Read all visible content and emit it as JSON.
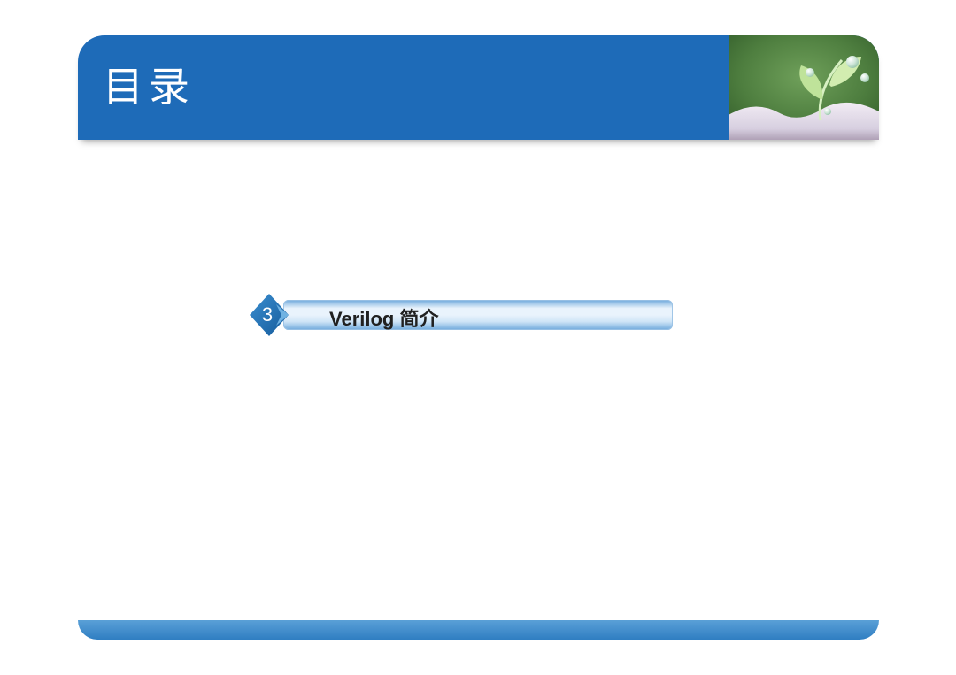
{
  "header": {
    "title": "目录"
  },
  "toc": {
    "item": {
      "number": "3",
      "label": "Verilog 简介"
    }
  },
  "colors": {
    "header_bg": "#1e6bb8",
    "diamond_fill": "#1e6bb8",
    "bar_light": "#e9f3fc",
    "bar_dark": "#6fa9dc",
    "footer_top": "#5aa0d7",
    "footer_bottom": "#2f7ec2"
  }
}
